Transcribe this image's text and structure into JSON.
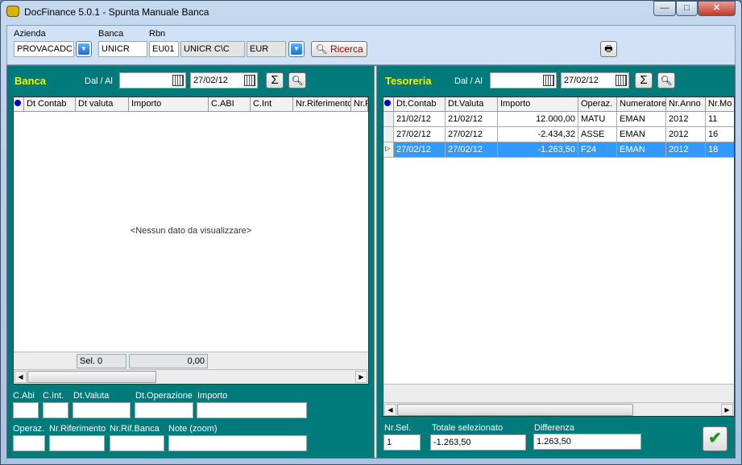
{
  "window": {
    "title": "DocFinance 5.0.1  - Spunta Manuale Banca",
    "minimize": "—",
    "maximize": "□",
    "close": "✕"
  },
  "header": {
    "azienda_label": "Azienda",
    "azienda_value": "PROVACADC",
    "banca_label": "Banca",
    "banca_value": "UNICR",
    "rbn_label": "Rbn",
    "rbn_value": "EU01",
    "conto_value": "UNICR C\\C",
    "valuta_value": "EUR",
    "ricerca_label": "Ricerca"
  },
  "banca": {
    "title": "Banca",
    "dal_al_label": "Dal / Al",
    "dal_value": "",
    "al_value": "27/02/12",
    "columns": [
      "Dt Contab",
      "Dt valuta",
      "Importo",
      "C.ABI",
      "C.Int",
      "Nr.Riferimento",
      "Nr.R"
    ],
    "empty_text": "<Nessun dato da visualizzare>",
    "sel_label": "Sel. 0",
    "sel_total": "0,00",
    "fields": {
      "c_abi": "C.Abi",
      "c_int": "C.Int.",
      "dt_valuta": "Dt.Valuta",
      "dt_operazione": "Dt.Operazione",
      "importo": "Importo",
      "operaz": "Operaz.",
      "nr_riferimento": "Nr.Riferimento",
      "nr_rif_banca": "Nr.Rif.Banca",
      "note": "Note (zoom)"
    }
  },
  "tesoreria": {
    "title": "Tesoreria",
    "dal_al_label": "Dal / Al",
    "dal_value": "",
    "al_value": "27/02/12",
    "columns": [
      "Dt.Contab",
      "Dt.Valuta",
      "Importo",
      "Operaz.",
      "Numeratore",
      "Nr.Anno",
      "Nr.Mo"
    ],
    "rows": [
      [
        "21/02/12",
        "21/02/12",
        "12.000,00",
        "MATU",
        "EMAN",
        "2012",
        "11"
      ],
      [
        "27/02/12",
        "27/02/12",
        "-2.434,32",
        "ASSE",
        "EMAN",
        "2012",
        "16"
      ],
      [
        "27/02/12",
        "27/02/12",
        "-1.263,50",
        "F24",
        "EMAN",
        "2012",
        "18"
      ]
    ],
    "selected_row": 2,
    "nr_sel_label": "Nr.Sel.",
    "nr_sel_value": "1",
    "totale_label": "Totale selezionato",
    "totale_value": "-1.263,50",
    "differenza_label": "Differenza",
    "differenza_value": "1.263,50"
  },
  "colors": {
    "panel": "#007a7a",
    "title_yellow": "#f2f200",
    "selection": "#3399ff"
  }
}
